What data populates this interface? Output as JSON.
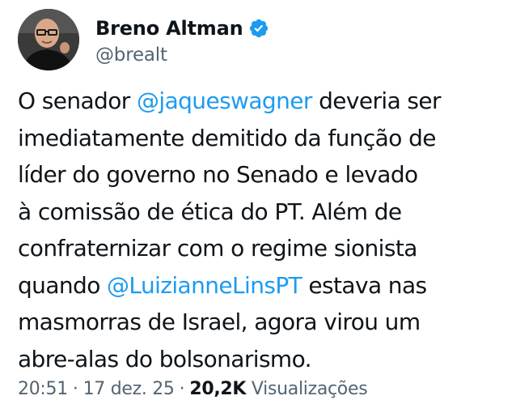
{
  "author": {
    "display_name": "Breno Altman",
    "handle": "@brealt",
    "verified": true
  },
  "tweet": {
    "lines": [
      [
        {
          "text": "O senador ",
          "type": "text"
        },
        {
          "text": "@jaqueswagner",
          "type": "mention"
        },
        {
          "text": " deveria ser",
          "type": "text"
        }
      ],
      [
        {
          "text": "imediatamente demitido da função de",
          "type": "text"
        }
      ],
      [
        {
          "text": "líder do governo no Senado e levado",
          "type": "text"
        }
      ],
      [
        {
          "text": "à comissão de ética do PT. Além de",
          "type": "text"
        }
      ],
      [
        {
          "text": "confraternizar com o regime sionista",
          "type": "text"
        }
      ],
      [
        {
          "text": "quando ",
          "type": "text"
        },
        {
          "text": "@LuizianneLinsPT",
          "type": "mention"
        },
        {
          "text": " estava nas",
          "type": "text"
        }
      ],
      [
        {
          "text": "masmorras de Israel, agora virou um",
          "type": "text"
        }
      ],
      [
        {
          "text": "abre-alas do bolsonarismo.",
          "type": "text"
        }
      ]
    ]
  },
  "meta": {
    "time": "20:51",
    "separator": "·",
    "date": "17 dez. 25",
    "views_count": "20,2K",
    "views_label": "Visualizações"
  },
  "colors": {
    "text": "#0f1419",
    "secondary": "#536471",
    "mention": "#1d9bf0",
    "verified_badge": "#1d9bf0"
  }
}
